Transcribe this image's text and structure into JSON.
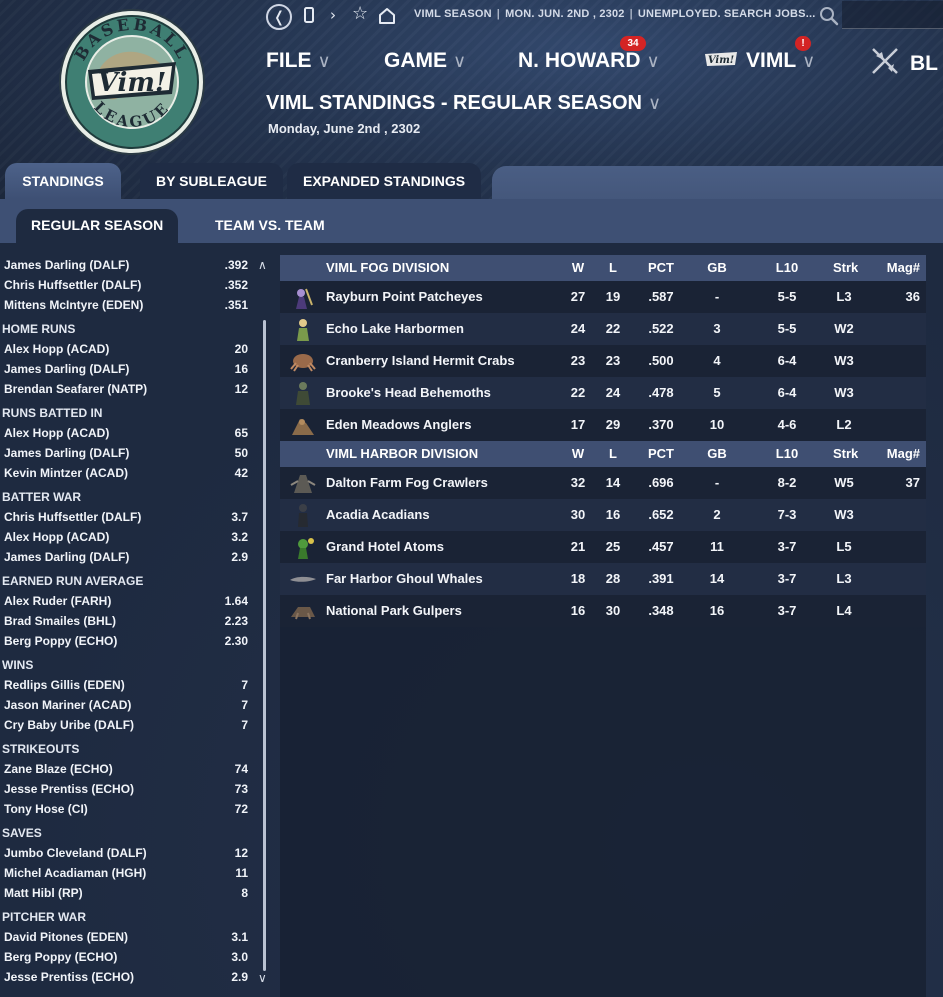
{
  "topbar": {
    "crumbs": [
      "VIML SEASON",
      "MON. JUN. 2ND , 2302",
      "UNEMPLOYED. SEARCH JOBS..."
    ],
    "back_icon": "back-icon",
    "icons": [
      "page-icon",
      "forward-icon",
      "star-icon",
      "home-icon",
      "search-icon"
    ]
  },
  "logo": {
    "top": "BASEBALL",
    "middle": "Vim!",
    "bottom": "LEAGUE"
  },
  "menu": {
    "file": "FILE",
    "game": "GAME",
    "manager": "N. HOWARD",
    "manager_badge": "34",
    "league": "VIML",
    "league_badge": "!",
    "partial": "BL"
  },
  "page": {
    "title": "VIML STANDINGS - REGULAR SEASON",
    "date": "Monday, June 2nd , 2302"
  },
  "tabs": [
    "STANDINGS",
    "BY SUBLEAGUE",
    "EXPANDED STANDINGS"
  ],
  "subtabs": [
    "REGULAR SEASON",
    "TEAM VS. TEAM"
  ],
  "leaders": {
    "top_rows": [
      {
        "name": "James Darling (DALF)",
        "value": ".392"
      },
      {
        "name": "Chris Huffsettler (DALF)",
        "value": ".352"
      },
      {
        "name": "Mittens McIntyre (EDEN)",
        "value": ".351"
      }
    ],
    "groups": [
      {
        "title": "HOME RUNS",
        "rows": [
          {
            "name": "Alex Hopp (ACAD)",
            "value": "20"
          },
          {
            "name": "James Darling (DALF)",
            "value": "16"
          },
          {
            "name": "Brendan Seafarer (NATP)",
            "value": "12"
          }
        ]
      },
      {
        "title": "RUNS BATTED IN",
        "rows": [
          {
            "name": "Alex Hopp (ACAD)",
            "value": "65"
          },
          {
            "name": "James Darling (DALF)",
            "value": "50"
          },
          {
            "name": "Kevin Mintzer (ACAD)",
            "value": "42"
          }
        ]
      },
      {
        "title": "BATTER WAR",
        "rows": [
          {
            "name": "Chris Huffsettler (DALF)",
            "value": "3.7"
          },
          {
            "name": "Alex Hopp (ACAD)",
            "value": "3.2"
          },
          {
            "name": "James Darling (DALF)",
            "value": "2.9"
          }
        ]
      },
      {
        "title": "EARNED RUN AVERAGE",
        "rows": [
          {
            "name": "Alex Ruder (FARH)",
            "value": "1.64"
          },
          {
            "name": "Brad Smailes (BHL)",
            "value": "2.23"
          },
          {
            "name": "Berg Poppy (ECHO)",
            "value": "2.30"
          }
        ]
      },
      {
        "title": "WINS",
        "rows": [
          {
            "name": "Redlips Gillis (EDEN)",
            "value": "7"
          },
          {
            "name": "Jason Mariner (ACAD)",
            "value": "7"
          },
          {
            "name": "Cry Baby Uribe (DALF)",
            "value": "7"
          }
        ]
      },
      {
        "title": "STRIKEOUTS",
        "rows": [
          {
            "name": "Zane Blaze (ECHO)",
            "value": "74"
          },
          {
            "name": "Jesse Prentiss (ECHO)",
            "value": "73"
          },
          {
            "name": "Tony Hose (CI)",
            "value": "72"
          }
        ]
      },
      {
        "title": "SAVES",
        "rows": [
          {
            "name": "Jumbo Cleveland (DALF)",
            "value": "12"
          },
          {
            "name": "Michel Acadiaman (HGH)",
            "value": "11"
          },
          {
            "name": "Matt Hibl (RP)",
            "value": "8"
          }
        ]
      },
      {
        "title": "PITCHER WAR",
        "rows": [
          {
            "name": "David Pitones (EDEN)",
            "value": "3.1"
          },
          {
            "name": "Berg Poppy (ECHO)",
            "value": "3.0"
          },
          {
            "name": "Jesse Prentiss (ECHO)",
            "value": "2.9"
          }
        ]
      }
    ]
  },
  "columns": {
    "w": "W",
    "l": "L",
    "pct": "PCT",
    "gb": "GB",
    "l10": "L10",
    "strk": "Strk",
    "mag": "Mag#"
  },
  "divisions": [
    {
      "name": "VIML FOG DIVISION",
      "teams": [
        {
          "name": "Rayburn Point Patcheyes",
          "w": "27",
          "l": "19",
          "pct": ".587",
          "gb": "-",
          "l10": "5-5",
          "strk": "L3",
          "mag": "36",
          "logo": "patcheye-logo"
        },
        {
          "name": "Echo Lake Harbormen",
          "w": "24",
          "l": "22",
          "pct": ".522",
          "gb": "3",
          "l10": "5-5",
          "strk": "W2",
          "mag": "",
          "logo": "harbormen-logo"
        },
        {
          "name": "Cranberry Island Hermit Crabs",
          "w": "23",
          "l": "23",
          "pct": ".500",
          "gb": "4",
          "l10": "6-4",
          "strk": "W3",
          "mag": "",
          "logo": "hermit-crab-logo"
        },
        {
          "name": "Brooke's Head Behemoths",
          "w": "22",
          "l": "24",
          "pct": ".478",
          "gb": "5",
          "l10": "6-4",
          "strk": "W3",
          "mag": "",
          "logo": "behemoth-logo"
        },
        {
          "name": "Eden Meadows Anglers",
          "w": "17",
          "l": "29",
          "pct": ".370",
          "gb": "10",
          "l10": "4-6",
          "strk": "L2",
          "mag": "",
          "logo": "angler-logo"
        }
      ]
    },
    {
      "name": "VIML HARBOR DIVISION",
      "teams": [
        {
          "name": "Dalton Farm Fog Crawlers",
          "w": "32",
          "l": "14",
          "pct": ".696",
          "gb": "-",
          "l10": "8-2",
          "strk": "W5",
          "mag": "37",
          "logo": "fog-crawler-logo"
        },
        {
          "name": "Acadia Acadians",
          "w": "30",
          "l": "16",
          "pct": ".652",
          "gb": "2",
          "l10": "7-3",
          "strk": "W3",
          "mag": "",
          "logo": "acadian-logo"
        },
        {
          "name": "Grand Hotel Atoms",
          "w": "21",
          "l": "25",
          "pct": ".457",
          "gb": "11",
          "l10": "3-7",
          "strk": "L5",
          "mag": "",
          "logo": "atom-logo"
        },
        {
          "name": "Far Harbor Ghoul Whales",
          "w": "18",
          "l": "28",
          "pct": ".391",
          "gb": "14",
          "l10": "3-7",
          "strk": "L3",
          "mag": "",
          "logo": "ghoul-whale-logo"
        },
        {
          "name": "National Park Gulpers",
          "w": "16",
          "l": "30",
          "pct": ".348",
          "gb": "16",
          "l10": "3-7",
          "strk": "L4",
          "mag": "",
          "logo": "gulper-logo"
        }
      ]
    }
  ],
  "colors": {
    "accent": "#3f4f72",
    "badge": "#d42424",
    "background": "#1e2a40"
  }
}
